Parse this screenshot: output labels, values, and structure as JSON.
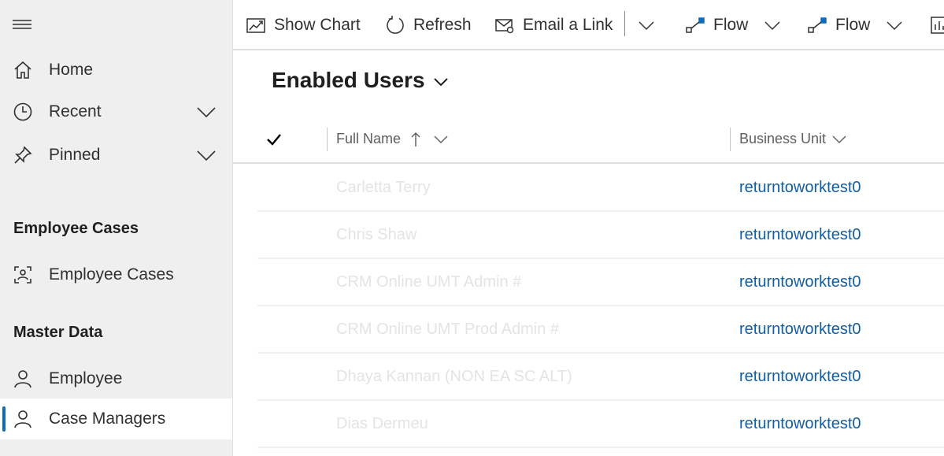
{
  "sidebar": {
    "nav": [
      {
        "label": "Home",
        "icon": "home-icon"
      },
      {
        "label": "Recent",
        "icon": "clock-icon"
      },
      {
        "label": "Pinned",
        "icon": "pin-icon"
      }
    ],
    "groups": [
      {
        "title": "Employee Cases",
        "items": [
          {
            "label": "Employee Cases",
            "icon": "contact-card-icon"
          }
        ]
      },
      {
        "title": "Master Data",
        "items": [
          {
            "label": "Employee",
            "icon": "person-icon"
          },
          {
            "label": "Case Managers",
            "icon": "person-icon",
            "selected": true
          }
        ]
      }
    ]
  },
  "toolbar": {
    "show_chart": "Show Chart",
    "refresh": "Refresh",
    "email_link": "Email a Link",
    "flow1": "Flow",
    "flow2": "Flow"
  },
  "view": {
    "title": "Enabled Users"
  },
  "grid": {
    "columns": [
      "Full Name",
      "Business Unit"
    ],
    "rows": [
      {
        "full_name": "Carletta Terry",
        "business_unit": "returntoworktest0"
      },
      {
        "full_name": "Chris Shaw",
        "business_unit": "returntoworktest0"
      },
      {
        "full_name": "CRM Online UMT Admin #",
        "business_unit": "returntoworktest0"
      },
      {
        "full_name": "CRM Online UMT Prod Admin #",
        "business_unit": "returntoworktest0"
      },
      {
        "full_name": "Dhaya Kannan (NON EA SC ALT)",
        "business_unit": "returntoworktest0"
      },
      {
        "full_name": "Dias Dermeu",
        "business_unit": "returntoworktest0"
      }
    ]
  },
  "colors": {
    "accent": "#0f6cbd",
    "link": "#115ea3",
    "sidebar_bg": "#efefef"
  }
}
